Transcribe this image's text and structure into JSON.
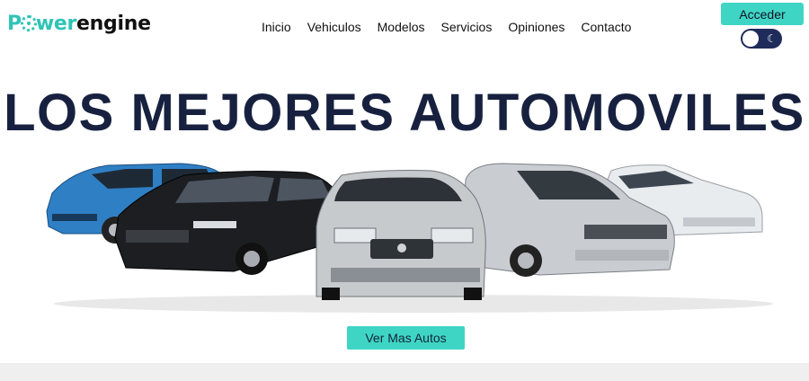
{
  "brand": {
    "part1": "P",
    "part2": "wer",
    "part3": "engine",
    "accent": "#2ec4b6"
  },
  "nav": {
    "items": [
      "Inicio",
      "Vehiculos",
      "Modelos",
      "Servicios",
      "Opiniones",
      "Contacto"
    ]
  },
  "header": {
    "login_label": "Acceder",
    "theme_toggle_icon": "moon-icon"
  },
  "hero": {
    "title": "LOS MEJORES AUTOMOVILES",
    "cta_label": "Ver Mas Autos",
    "image": "cars-lineup"
  },
  "colors": {
    "button": "#3fd5c5",
    "title": "#17213f",
    "toggle": "#1f2b5a",
    "strip": "#efefef"
  }
}
